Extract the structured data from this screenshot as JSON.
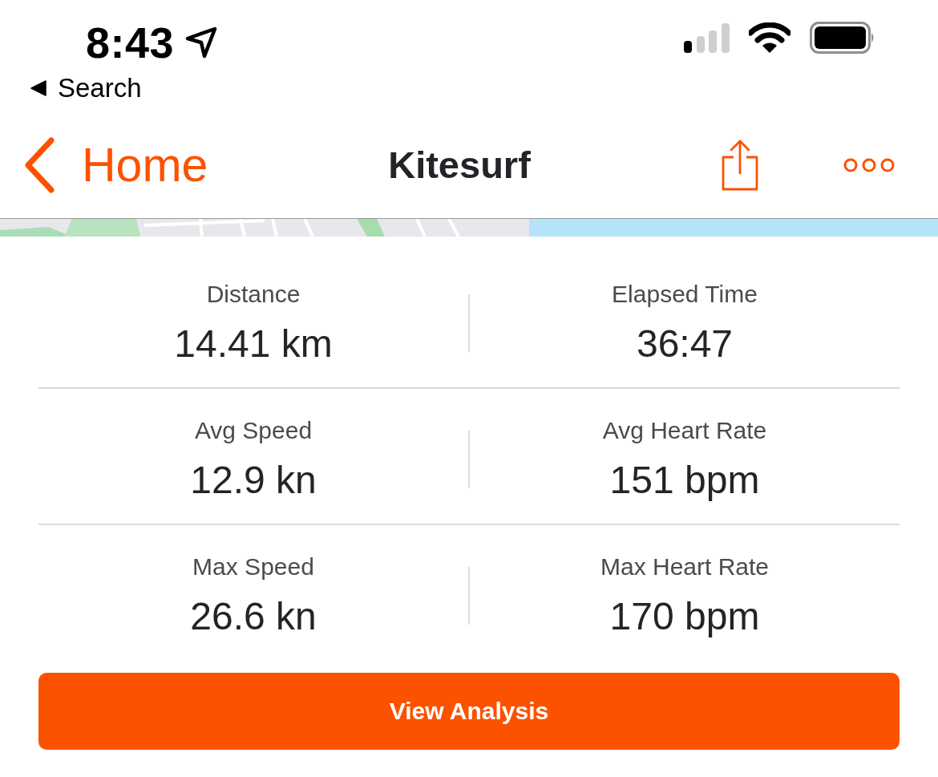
{
  "status_bar": {
    "time": "8:43",
    "back_link": "Search"
  },
  "nav_bar": {
    "back_label": "Home",
    "title": "Kitesurf"
  },
  "stat_rows": [
    {
      "cells": [
        {
          "label": "Distance",
          "value": "14.41 km"
        },
        {
          "label": "Elapsed Time",
          "value": "36:47"
        }
      ]
    },
    {
      "cells": [
        {
          "label": "Avg Speed",
          "value": "12.9 kn"
        },
        {
          "label": "Avg Heart Rate",
          "value": "151 bpm"
        }
      ]
    },
    {
      "cells": [
        {
          "label": "Max Speed",
          "value": "26.6 kn"
        },
        {
          "label": "Max Heart Rate",
          "value": "170 bpm"
        }
      ]
    }
  ],
  "primary_button": {
    "label": "View Analysis"
  }
}
